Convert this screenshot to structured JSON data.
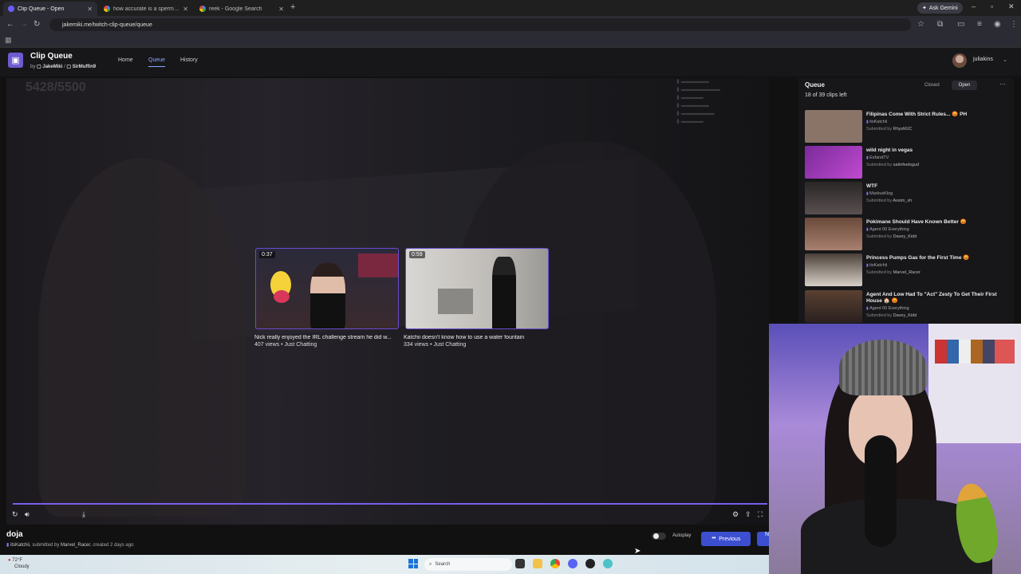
{
  "browser": {
    "tabs": [
      {
        "title": "Clip Queue - Open",
        "active": true
      },
      {
        "title": "how accurate is a sperm fertili...",
        "active": false
      },
      {
        "title": "reek - Google Search",
        "active": false
      }
    ],
    "gemini_label": "Ask Gemini",
    "url": "jakemiki.me/twitch-clip-queue/queue"
  },
  "app": {
    "title": "Clip Queue",
    "by": "by",
    "author1": "JakeMiki",
    "author2": "SirMuffin9",
    "nav": [
      "Home",
      "Queue",
      "History"
    ],
    "username": "juliakins"
  },
  "player": {
    "counter": "5428/5500",
    "suggestions": [
      {
        "duration": "0:37",
        "title": "Nick really enjoyed the IRL challenge stream he did w...",
        "meta": "407 views • Just Chatting"
      },
      {
        "duration": "0:59",
        "title": "Katchii doesn't know how to use a water fountain",
        "meta": "334 views • Just Chatting"
      }
    ]
  },
  "clip": {
    "title": "doja",
    "channel": "itsKatchii",
    "submitted_by_label": ", submitted by",
    "submitter": "Marvel_Racer",
    "created": ", created 2 days ago"
  },
  "controls": {
    "autoplay_label": "Autoplay",
    "previous_label": "Previous",
    "next_label": "N"
  },
  "queue": {
    "title": "Queue",
    "closed_label": "Closed",
    "open_label": "Open",
    "count": "18 of 39 clips left",
    "items": [
      {
        "title": "Filipinas Come With Strict Rules... 😡 PH",
        "channel": "itsKatchii",
        "submitter": "RhysMJC",
        "color": "#8a7468"
      },
      {
        "title": "wild night in vegas",
        "channel": "EsfandTV",
        "submitter": "satinfeelsgud",
        "color": "#7a2a9a"
      },
      {
        "title": "WTF",
        "channel": "MarkusKlog",
        "submitter": "Assim_vh",
        "color": "#3a3536"
      },
      {
        "title": "Pokimane Should Have Known Better 😡",
        "channel": "Agent 00 Everything",
        "submitter": "Davey_Kidd",
        "color": "#6a4a3a"
      },
      {
        "title": "Princess Pumps Gas for the First Time 😡",
        "channel": "itsKatchii",
        "submitter": "Marvel_Racer",
        "color": "#4a4038"
      },
      {
        "title": "Agent And Low Had To \"Act\" Zesty To Get Their First House 🏠 😡",
        "channel": "Agent 00 Everything",
        "submitter": "Davey_Kidd",
        "color": "#5a4030"
      }
    ],
    "submitted_prefix": "Submitted by"
  },
  "taskbar": {
    "temp": "72°F",
    "weather": "Cloudy",
    "search_placeholder": "Search"
  },
  "colors": {
    "accent": "#7a5cf0",
    "button": "#3b4fd0"
  }
}
